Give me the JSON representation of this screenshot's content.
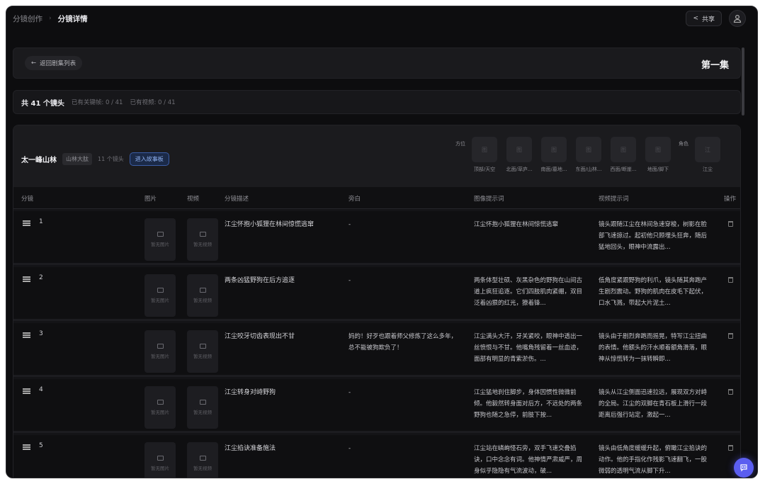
{
  "breadcrumb": {
    "parent": "分镜创作",
    "current": "分镜详情"
  },
  "header": {
    "share_label": "共享"
  },
  "episode": {
    "back_label": "返回剧集列表",
    "title": "第一集"
  },
  "stats": {
    "total": "共 41 个镜头",
    "keyframes": "已有关键帧: 0 / 41",
    "videos": "已有视频: 0 / 41"
  },
  "scene": {
    "name": "太一峰山林",
    "tag": "山林大肽",
    "count": "11 个镜头",
    "story_button": "进入故事板",
    "direction_label": "方位",
    "role_label": "角色",
    "directions": [
      {
        "icon": "图",
        "label": "顶部/天空"
      },
      {
        "icon": "图",
        "label": "北面/草庐..."
      },
      {
        "icon": "图",
        "label": "南面/墓地..."
      },
      {
        "icon": "图",
        "label": "东面/山林..."
      },
      {
        "icon": "图",
        "label": "西面/断崖..."
      },
      {
        "icon": "图",
        "label": "地面/脚下"
      }
    ],
    "roles": [
      {
        "icon": "江",
        "label": "江尘"
      }
    ]
  },
  "columns": [
    "分镜",
    "图片",
    "视频",
    "分镜描述",
    "旁白",
    "图像提示词",
    "视频提示词",
    "操作"
  ],
  "placeholders": {
    "image": "暂无图片",
    "video": "暂无视频"
  },
  "rows": [
    {
      "num": "1",
      "desc": "江尘怀抱小狐狸在林间惊慌逃窜",
      "narration": "-",
      "image_prompt": "江尘怀抱小狐狸在林间惊慌逃窜",
      "video_prompt": "镜头跟随江尘在林间急速穿梭，树影在脸部飞速掠过。起初他只顾埋头狂奔，随后猛地回头，眼神中流露出..."
    },
    {
      "num": "2",
      "desc": "两条凶猛野狗在后方追逐",
      "narration": "-",
      "image_prompt": "两条体型壮硕、灰黑杂色的野狗在山间古道上疯狂追逐。它们四肢肌肉紧绷，双目泛着凶狠的红光，獠着锋...",
      "video_prompt": "低角度紧跟野狗的利爪，镜头随其奔跑产生剧烈震动。野狗的肌肉在皮毛下起伏，口水飞溅，带起大片泥土..."
    },
    {
      "num": "3",
      "desc": "江尘咬牙切齿表现出不甘",
      "narration": "妈的！好歹也跟着师父修炼了这么多年，总不能被狗欺负了！",
      "image_prompt": "江尘满头大汗，牙关紧咬，眼神中透出一丝愤恨与不甘。他嘴角残留着一丝血迹，面部有明显的青紫淤伤。...",
      "video_prompt": "镜头由于剧烈奔跑而摇晃，特写江尘扭曲的表情。他额头的汗水顺着额角滑落，眼神从惊慌转为一抹转瞬即..."
    },
    {
      "num": "4",
      "desc": "江尘转身对峙野狗",
      "narration": "-",
      "image_prompt": "江尘猛地刹住脚步，身体因惯性微微前倾。他毅然转身面对后方，不远处的两条野狗也随之急停，前肢下按...",
      "video_prompt": "镜头从江尘侧面迅速拉远，展现双方对峙的全局。江尘的双脚在青石板上滑行一段距离后强行站定，激起一..."
    },
    {
      "num": "5",
      "desc": "江尘掐诀准备施法",
      "narration": "-",
      "image_prompt": "江尘站在嶙峋怪石旁，双手飞速交叠掐诀，口中念念有词。他神情严肃威严，周身似乎隐隐有气流波动，破...",
      "video_prompt": "镜头由低角度缓缓升起，俯瞰江尘掐诀的动作。他的手指化作残影飞速翻飞，一股微弱的透明气流从脚下升..."
    }
  ],
  "colors": {
    "accent": "#5b5ef0",
    "background": "#0d0d0f",
    "story_button": "#3b5ea8"
  }
}
